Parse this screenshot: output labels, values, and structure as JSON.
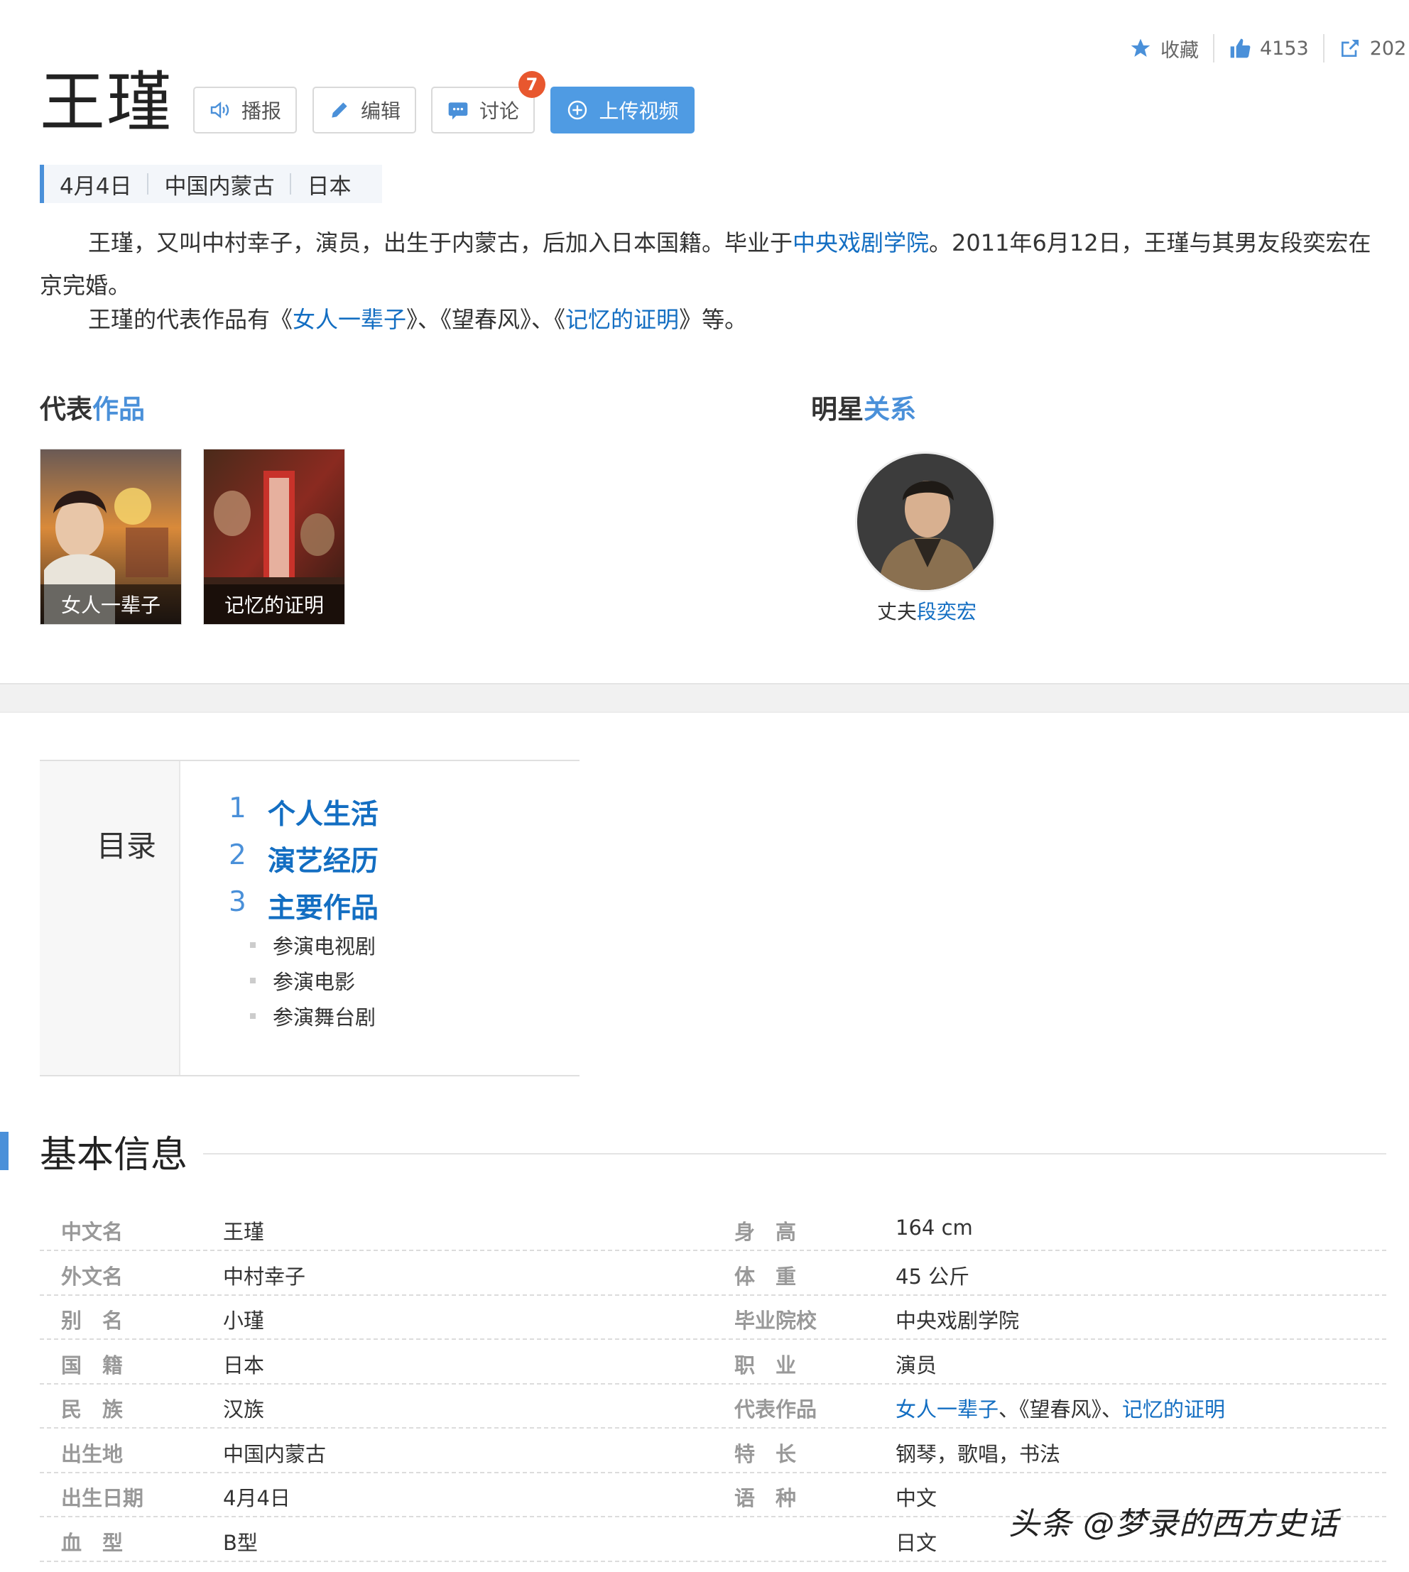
{
  "top_actions": {
    "collect": "收藏",
    "like_count": "4153",
    "share_count": "202"
  },
  "title": "王瑾",
  "toolbar": {
    "broadcast": "播报",
    "edit": "编辑",
    "discuss": "讨论",
    "discuss_badge": "7",
    "upload": "上传视频"
  },
  "tags": [
    "4月4日",
    "中国内蒙古",
    "日本"
  ],
  "summary": {
    "p1_a": "王瑾，又叫中村幸子，演员，出生于内蒙古，后加入日本国籍。毕业于",
    "p1_link": "中央戏剧学院",
    "p1_b": "。2011年6月12日，王瑾与其男友段奕宏在京完婚。",
    "p2_a": "王瑾的代表作品有《",
    "p2_link1": "女人一辈子",
    "p2_b": "》、《望春风》、《",
    "p2_link2": "记忆的证明",
    "p2_c": "》等。"
  },
  "works": {
    "head_a": "代表",
    "head_b": "作品",
    "items": [
      "女人一辈子",
      "记忆的证明"
    ]
  },
  "relation": {
    "head_a": "明星",
    "head_b": "关系",
    "role": "丈夫",
    "name": "段奕宏"
  },
  "toc": {
    "label": "目录",
    "items": [
      {
        "num": "1",
        "text": "个人生活"
      },
      {
        "num": "2",
        "text": "演艺经历"
      },
      {
        "num": "3",
        "text": "主要作品"
      }
    ],
    "subs": [
      "参演电视剧",
      "参演电影",
      "参演舞台剧"
    ]
  },
  "basic_info": {
    "title": "基本信息",
    "left": [
      {
        "k": "中文名",
        "v": "王瑾"
      },
      {
        "k": "外文名",
        "v": "中村幸子"
      },
      {
        "k": "别　名",
        "v": "小瑾"
      },
      {
        "k": "国　籍",
        "v": "日本"
      },
      {
        "k": "民　族",
        "v": "汉族"
      },
      {
        "k": "出生地",
        "v": "中国内蒙古"
      },
      {
        "k": "出生日期",
        "v": "4月4日"
      },
      {
        "k": "血　型",
        "v": "B型"
      }
    ],
    "right": [
      {
        "k": "身　高",
        "v": "164 cm"
      },
      {
        "k": "体　重",
        "v": "45 公斤"
      },
      {
        "k": "毕业院校",
        "v": "中央戏剧学院"
      },
      {
        "k": "职　业",
        "v": "演员"
      },
      {
        "k": "代表作品",
        "v_link1": "女人一辈子",
        "v_mid": "、《望春风》、",
        "v_link2": "记忆的证明"
      },
      {
        "k": "特　长",
        "v": "钢琴，歌唱，书法"
      },
      {
        "k": "语　种",
        "v": "中文"
      },
      {
        "k": "",
        "v": "日文"
      }
    ]
  },
  "watermark": "头条 @梦录的西方史话"
}
